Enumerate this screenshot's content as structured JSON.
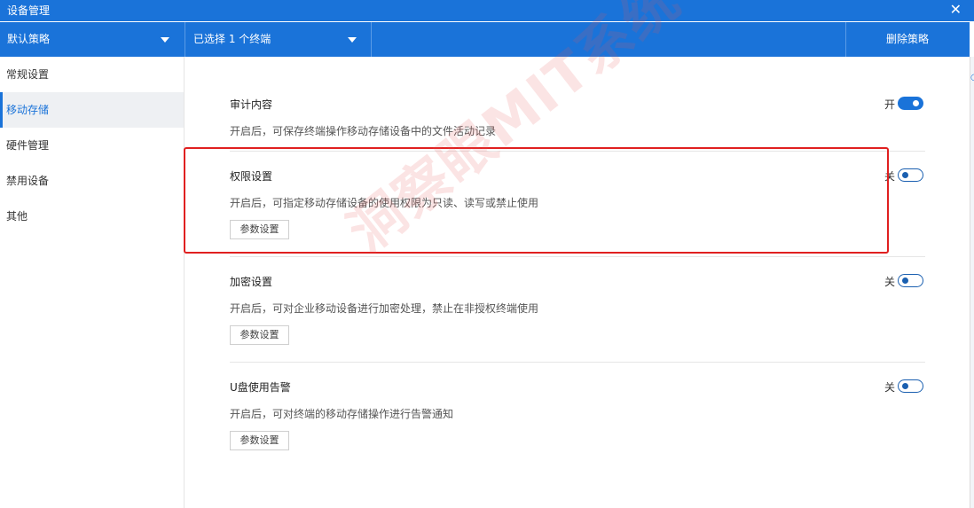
{
  "window": {
    "title": "设备管理",
    "close_glyph": "✕"
  },
  "toolbar": {
    "policy": "默认策略",
    "selection": "已选择 1 个终端",
    "delete_label": "删除策略"
  },
  "sidebar": {
    "items": [
      {
        "label": "常规设置"
      },
      {
        "label": "移动存储"
      },
      {
        "label": "硬件管理"
      },
      {
        "label": "禁用设备"
      },
      {
        "label": "其他"
      }
    ],
    "active_index": 1
  },
  "sections": [
    {
      "title": "审计内容",
      "desc": "开启后，可保存终端操作移动存储设备中的文件活动记录",
      "state_label": "开",
      "enabled": true
    },
    {
      "title": "权限设置",
      "desc": "开启后，可指定移动存储设备的使用权限为只读、读写或禁止使用",
      "state_label": "关",
      "enabled": false,
      "button": "参数设置"
    },
    {
      "title": "加密设置",
      "desc": "开启后，可对企业移动设备进行加密处理，禁止在非授权终端使用",
      "state_label": "关",
      "enabled": false,
      "button": "参数设置"
    },
    {
      "title": "U盘使用告警",
      "desc": "开启后，可对终端的移动存储操作进行告警通知",
      "state_label": "关",
      "enabled": false,
      "button": "参数设置"
    }
  ],
  "watermark": "洞察眼MIT系统",
  "colors": {
    "accent": "#1a73d9",
    "highlight": "#e02020"
  }
}
